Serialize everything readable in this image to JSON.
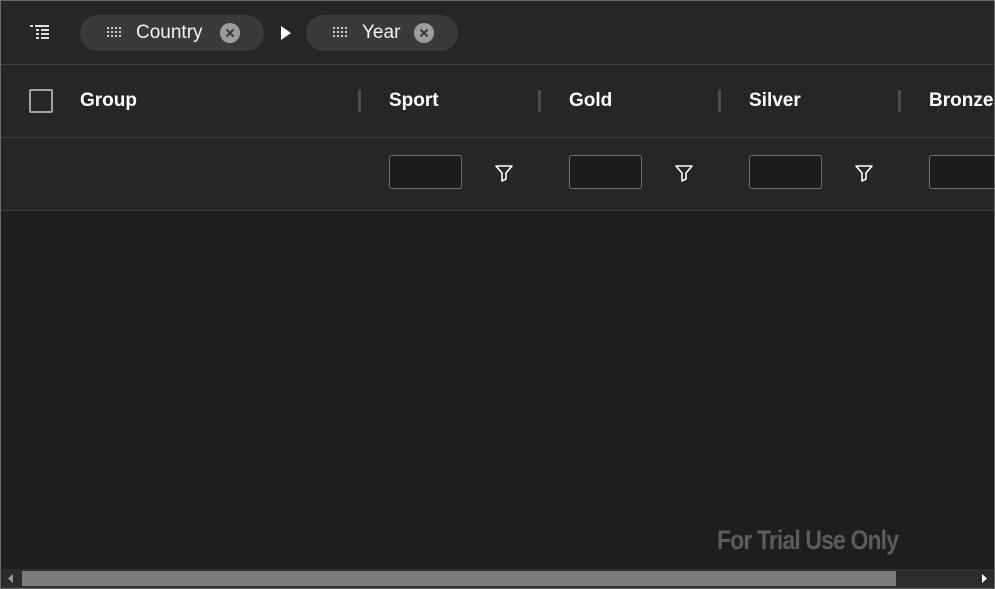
{
  "group_panel": {
    "menu_icon": "tree-list-icon",
    "chips": [
      {
        "label": "Country",
        "grip_icon": "drag-grip-icon",
        "remove_icon": "close-circle-icon"
      },
      {
        "label": "Year",
        "grip_icon": "drag-grip-icon",
        "remove_icon": "close-circle-icon"
      }
    ],
    "separator_icon": "triangle-right-icon"
  },
  "header": {
    "columns": [
      "Group",
      "Sport",
      "Gold",
      "Silver",
      "Bronze"
    ]
  },
  "filters": {
    "inputs": [
      {
        "column": "Sport",
        "value": ""
      },
      {
        "column": "Gold",
        "value": ""
      },
      {
        "column": "Silver",
        "value": ""
      },
      {
        "column": "Bronze",
        "value": ""
      }
    ],
    "filter_icon": "funnel-icon"
  },
  "watermark": "For Trial Use Only",
  "colors": {
    "background": "#1e1e1e",
    "header_background": "#262626",
    "chip_background": "#3a3a3a",
    "border": "#3e3e3e",
    "scroll_thumb": "#7b7b7b",
    "watermark": "#5c5c5c"
  }
}
